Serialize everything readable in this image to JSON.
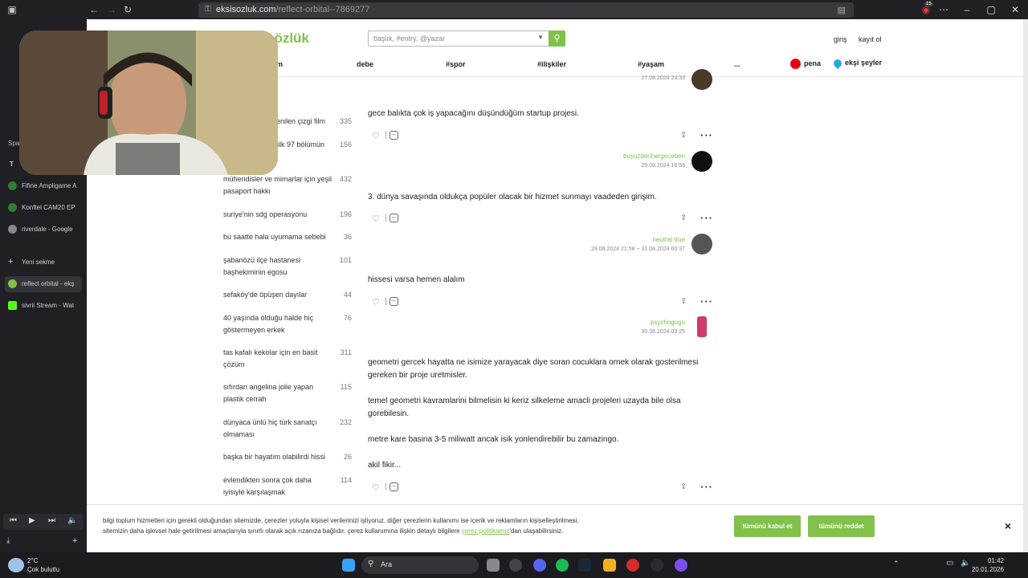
{
  "browser": {
    "url_domain": "eksisozluk.com",
    "url_path": "/reflect-orbital--7869277",
    "badge": "15"
  },
  "tabs_sidebar": {
    "section": "Spa",
    "items": [
      {
        "label": "Fifine Ampligame A"
      },
      {
        "label": "Konftel CAM20 EP"
      },
      {
        "label": "riverdale - Google"
      },
      {
        "label": "Yeni sekme"
      },
      {
        "label": "reflect orbital - ekş"
      },
      {
        "label": "sivrii Stream - Wat"
      }
    ]
  },
  "header": {
    "logo": "sözlük",
    "search_placeholder": "başlık, #entry, @yazar",
    "login": "giriş",
    "register": "kayıt ol",
    "nav": [
      "m",
      "debe",
      "#spor",
      "#ilişkiler",
      "#yaşam",
      "..."
    ],
    "pena": "pena",
    "eksi_seyler": "ekşi şeyler"
  },
  "left_list": [
    {
      "title": "lenilen çizgi film",
      "count": "335"
    },
    {
      "title": "ilk 97 bölümün",
      "count": "156"
    },
    {
      "title": "mühendisler ve mimarlar için yeşil pasaport hakkı",
      "count": "432"
    },
    {
      "title": "suriye'nin sdg operasyonu",
      "count": "196"
    },
    {
      "title": "bu saatte hala uyumama sebebi",
      "count": "36"
    },
    {
      "title": "şabanözü ilçe hastanesi başhekiminin egosu",
      "count": "101"
    },
    {
      "title": "sefaköy'de öpüşen dayılar",
      "count": "44"
    },
    {
      "title": "40 yaşında olduğu halde hiç göstermeyen erkek",
      "count": "76"
    },
    {
      "title": "tas kafalı kekolar için en basit çözüm",
      "count": "311"
    },
    {
      "title": "sıfırdan angelina jolie yapan plastik cerrah",
      "count": "115"
    },
    {
      "title": "dünyaca ünlü hiç türk sanatçı olmaması",
      "count": "232"
    },
    {
      "title": "başka bir hayatım olabilirdi hissi",
      "count": "26"
    },
    {
      "title": "evlendikten sonra çok daha iyisiyle karşılaşmak",
      "count": "114"
    }
  ],
  "entries": [
    {
      "date": "27.08.2024 23:33"
    },
    {
      "text": "gece balıkta çok iş yapacağını düşündüğüm startup projesi.",
      "author": "buyuzdenhergeceben",
      "date": "29.08.2024 16:58"
    },
    {
      "text": "3. dünya savaşında oldukça popüler olacak bir hizmet sunmayı vaadeden girişim.",
      "author": "neutral true",
      "date": "29.08.2024 21:58 ~ 31.08.2024 00:37"
    },
    {
      "text": "hissesi varsa hemen alalım",
      "author": "psychogugu",
      "date": "30.08.2024 09:25"
    },
    {
      "paragraphs": [
        "geometri gercek hayatta ne isimize yarayacak diye soran cocuklara ornek olarak gosterilmesi gereken bir proje uretmisler.",
        "temel geometri kavramlarini bilmelisin ki keriz silkeleme amacli projeleri uzayda bile olsa gorebilesin.",
        "metre kare basina 3-5 miliwatt ancak isik yonlendirebilir bu zamazingo.",
        "akil fikir..."
      ]
    }
  ],
  "cookie": {
    "text_1": "bilgi toplum hizmetleri için gerekli olduğundan sitemizde, çerezler yoluyla kişisel verilerinizi işliyoruz. diğer çerezlerin kullanımı ise içerik ve reklamların kişiselleştirilmesi,",
    "text_2": "sitemizin daha işlevsel hale getirilmesi amaçlarıyla sınırlı olarak açık rızanıza bağlıdır. çerez kullanımına ilişkin detaylı bilgilere ",
    "link": "çerez politikamız",
    "text_3": "'dan ulaşabilirsiniz.",
    "accept": "tümünü kabul et",
    "reject": "tümünü reddet",
    "close": "×"
  },
  "taskbar": {
    "weather_temp": "2°C",
    "weather_desc": "Çok bulutlu",
    "search": "Ara",
    "time": "01:42",
    "date": "20.01.2026"
  },
  "colors": {
    "accent": "#81c14b",
    "pena": "#e30613",
    "eksi_seyler": "#29a8e0"
  }
}
